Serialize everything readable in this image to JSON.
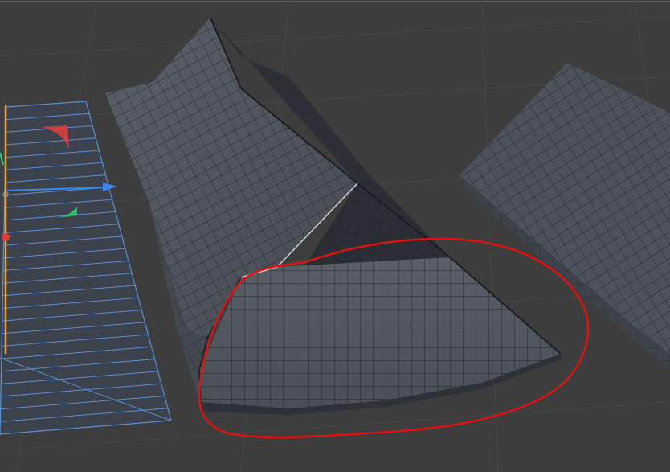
{
  "viewport": {
    "background_color": "#3d3d3d",
    "grid_color": "#4a4a4a",
    "mesh_fill_color": "#4e535b",
    "mesh_shade_color": "#3f434a",
    "mesh_dark_color": "#2a2d33",
    "wire_color": "#1e2126",
    "selection_wire_color": "#5b8fd6",
    "annotation_color": "#e01212",
    "gizmo": {
      "x_axis_color": "#e03c3c",
      "y_axis_color": "#2ecc71",
      "z_axis_color": "#3d86f0",
      "highlight_axis_color": "#f0a030"
    },
    "objects": [
      "selected-plane-object",
      "bent-roof-mesh-object",
      "flat-slab-mesh-object"
    ],
    "annotation": "red-freehand-circle"
  }
}
